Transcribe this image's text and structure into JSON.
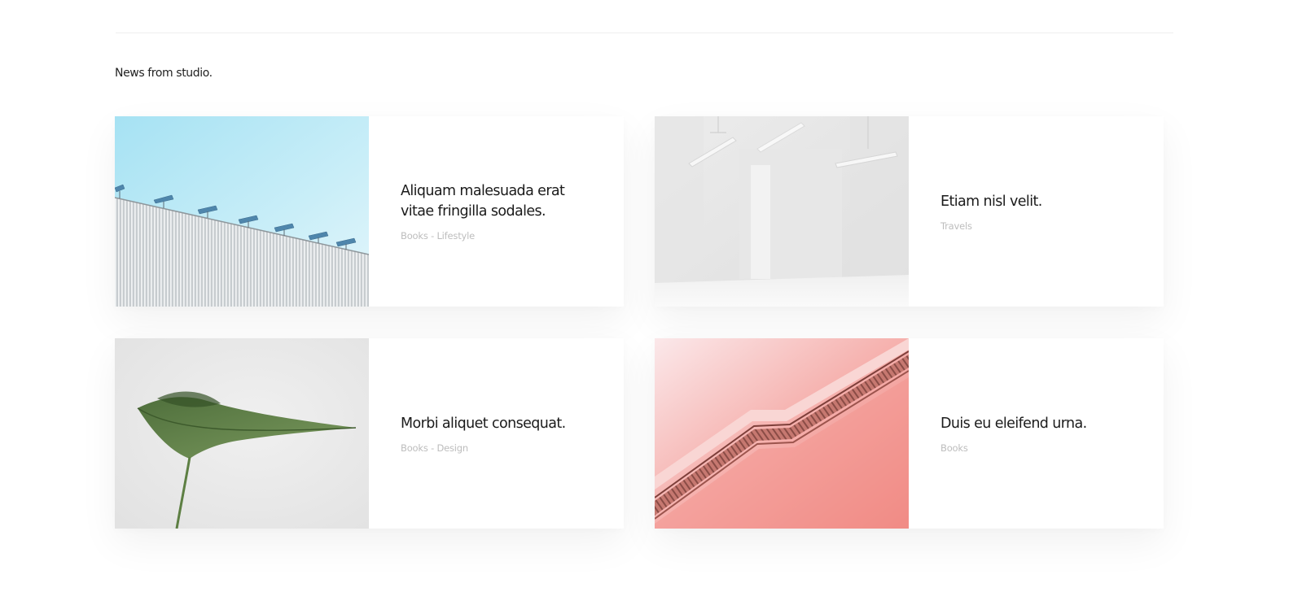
{
  "section": {
    "title": "News from studio."
  },
  "posts": [
    {
      "title": "Aliquam malesuada erat vitae fringilla sodales.",
      "meta": "Books - Lifestyle",
      "image": "building-rooftop-image"
    },
    {
      "title": "Etiam nisl velit.",
      "meta": "Travels",
      "image": "white-room-image"
    },
    {
      "title": "Morbi aliquet consequat.",
      "meta": "Books - Design",
      "image": "green-leaf-image"
    },
    {
      "title": "Duis eu eleifend urna.",
      "meta": "Books",
      "image": "pink-escalator-image"
    }
  ],
  "colors": {
    "background": "#ffffff",
    "title": "#1b1b1b",
    "meta": "#bdbdbd",
    "divider": "#eeeeee"
  }
}
